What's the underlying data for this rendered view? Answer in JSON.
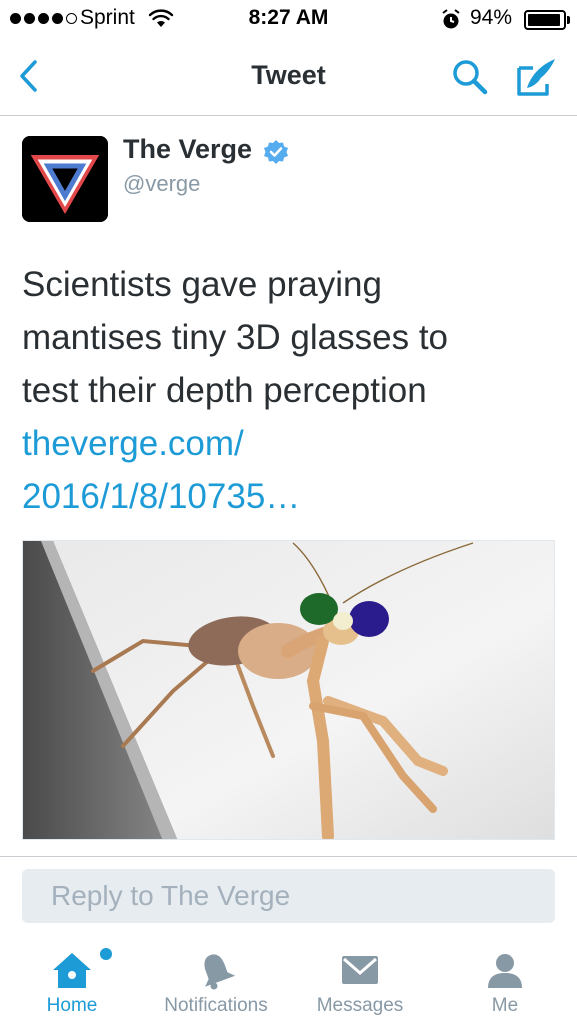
{
  "status_bar": {
    "carrier": "Sprint",
    "time": "8:27 AM",
    "battery_percent": "94%",
    "battery_level": 0.94,
    "signal_bars_filled": 4,
    "signal_bars_total": 5
  },
  "nav": {
    "title": "Tweet",
    "icons": [
      "back-chevron-icon",
      "search-icon",
      "compose-icon"
    ]
  },
  "tweet": {
    "author": {
      "display_name": "The Verge",
      "handle": "@verge",
      "verified": true
    },
    "text_lines": [
      "Scientists gave praying",
      "mantises tiny 3D glasses to",
      "test their depth perception"
    ],
    "link_lines": [
      "theverge.com/",
      "2016/1/8/10735…"
    ]
  },
  "reply": {
    "placeholder": "Reply to The Verge"
  },
  "tabbar": {
    "items": [
      {
        "label": "Home",
        "icon": "home-icon",
        "active": true,
        "has_badge": true
      },
      {
        "label": "Notifications",
        "icon": "bell-icon",
        "active": false
      },
      {
        "label": "Messages",
        "icon": "envelope-icon",
        "active": false
      },
      {
        "label": "Me",
        "icon": "person-icon",
        "active": false
      }
    ]
  },
  "colors": {
    "accent": "#1d9bd6",
    "text": "#292f33",
    "muted": "#8899a6"
  }
}
